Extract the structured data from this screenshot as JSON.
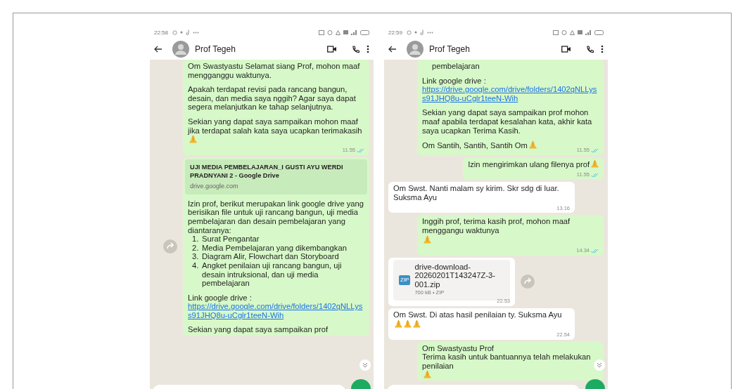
{
  "phones": [
    {
      "status_time": "22:58",
      "contact": "Prof Tegeh",
      "messages": [
        {
          "kind": "text",
          "outgoing": true,
          "blocks": [
            {
              "kind": "para",
              "text": "Om Swastyastu Selamat siang Prof, mohon maaf mengganggu waktunya."
            },
            {
              "kind": "para",
              "text": "Apakah terdapat revisi pada rancang bangun, desain, dan media saya nggih? Agar saya dapat segera melanjutkan ke tahap selanjutnya."
            },
            {
              "kind": "para",
              "text": "Sekian yang dapat saya sampaikan mohon maaf jika terdapat salah kata saya ucapkan terimakasih",
              "emoji": [
                {
                  "kind": "pray"
                }
              ]
            }
          ],
          "time": "11.55",
          "read": true,
          "forward": false
        },
        {
          "kind": "link",
          "outgoing": true,
          "preview_title": "UJI MEDIA PEMBELAJARAN_I GUSTI AYU WERDI PRADNYANI 2 - Google Drive",
          "preview_domain": "drive.google.com",
          "blocks": [
            {
              "kind": "para",
              "text": "Izin prof, berikut merupakan link google drive yang berisikan file untuk uji rancang bangun, uji media pembelajaran dan desain pembelajaran yang diantaranya:"
            },
            {
              "kind": "list",
              "items": [
                {
                  "number": "1.",
                  "text": "Surat Pengantar"
                },
                {
                  "number": "2.",
                  "text": "Media Pembelajaran yang dikembangkan"
                },
                {
                  "number": "3.",
                  "text": "Diagram Alir, Flowchart dan Storyboard"
                },
                {
                  "number": "4.",
                  "text": "Angket penilaian uji rancang bangun, uji desain intruksional, dan uji media pembelajaran"
                }
              ]
            },
            {
              "kind": "label",
              "text": "Link google drive :"
            },
            {
              "kind": "url",
              "text": "https://drive.google.com/drive/folders/1402qNLLyss91JHQ8u-uCglr1teeN-Wih"
            },
            {
              "kind": "para",
              "text": "Sekian yang dapat saya sampaikan prof"
            }
          ],
          "forward": true
        }
      ]
    },
    {
      "status_time": "22:59",
      "contact": "Prof Tegeh",
      "messages": [
        {
          "kind": "text",
          "outgoing": true,
          "blocks": [
            {
              "kind": "indent",
              "text": "pembelajaran"
            },
            {
              "kind": "label",
              "text": "Link google drive :"
            },
            {
              "kind": "url",
              "text": "https://drive.google.com/drive/folders/1402qNLLyss91JHQ8u-uCglr1teeN-Wih"
            },
            {
              "kind": "para",
              "text": "Sekian yang dapat saya sampaikan prof mohon maaf apabila terdapat kesalahan kata, akhir kata saya ucapkan Terima Kasih."
            },
            {
              "kind": "line",
              "text": "Om Santih, Santih, Santih Om",
              "emoji": [
                {
                  "kind": "pray"
                }
              ]
            }
          ],
          "time": "11.55",
          "read": true,
          "forward": false
        },
        {
          "kind": "text",
          "outgoing": true,
          "blocks": [
            {
              "kind": "para",
              "text": "Izin mengirimkan ulang filenya prof",
              "emoji": [
                {
                  "kind": "pray"
                }
              ]
            }
          ],
          "time": "11.55",
          "read": true,
          "forward": false
        },
        {
          "kind": "text",
          "outgoing": false,
          "blocks": [
            {
              "kind": "para",
              "text": "Om Swst. Nanti malam sy kirim. Skr sdg di luar. Suksma Ayu"
            }
          ],
          "time": "13.16",
          "forward": false
        },
        {
          "kind": "text",
          "outgoing": true,
          "blocks": [
            {
              "kind": "para",
              "text": "Inggih prof, terima kasih prof, mohon maaf menggangu waktunya",
              "emoji": [
                {
                  "kind": "pray"
                }
              ]
            }
          ],
          "time": "14.34",
          "read": true,
          "forward": false
        },
        {
          "kind": "file",
          "outgoing": false,
          "file_name": "drive-download-20260201T143247Z-3-001.zip",
          "file_badge": "ZIP",
          "file_meta": "700 kB • ZIP",
          "time": "22.53",
          "forward": true
        },
        {
          "kind": "text",
          "outgoing": false,
          "blocks": [
            {
              "kind": "para",
              "text": "Om Swst. Di atas hasil penilaian ty. Suksma Ayu",
              "emoji": [
                {
                  "kind": "pray"
                },
                {
                  "kind": "pray"
                },
                {
                  "kind": "pray"
                }
              ]
            }
          ],
          "time": "22.54",
          "forward": false
        },
        {
          "kind": "text",
          "outgoing": true,
          "blocks": [
            {
              "kind": "line",
              "text": "Om Swastyastu Prof"
            },
            {
              "kind": "line",
              "text": "Terima kasih untuk bantuannya telah melakukan penilaian",
              "emoji": [
                {
                  "kind": "pray"
                }
              ]
            }
          ],
          "forward": false
        }
      ]
    }
  ]
}
